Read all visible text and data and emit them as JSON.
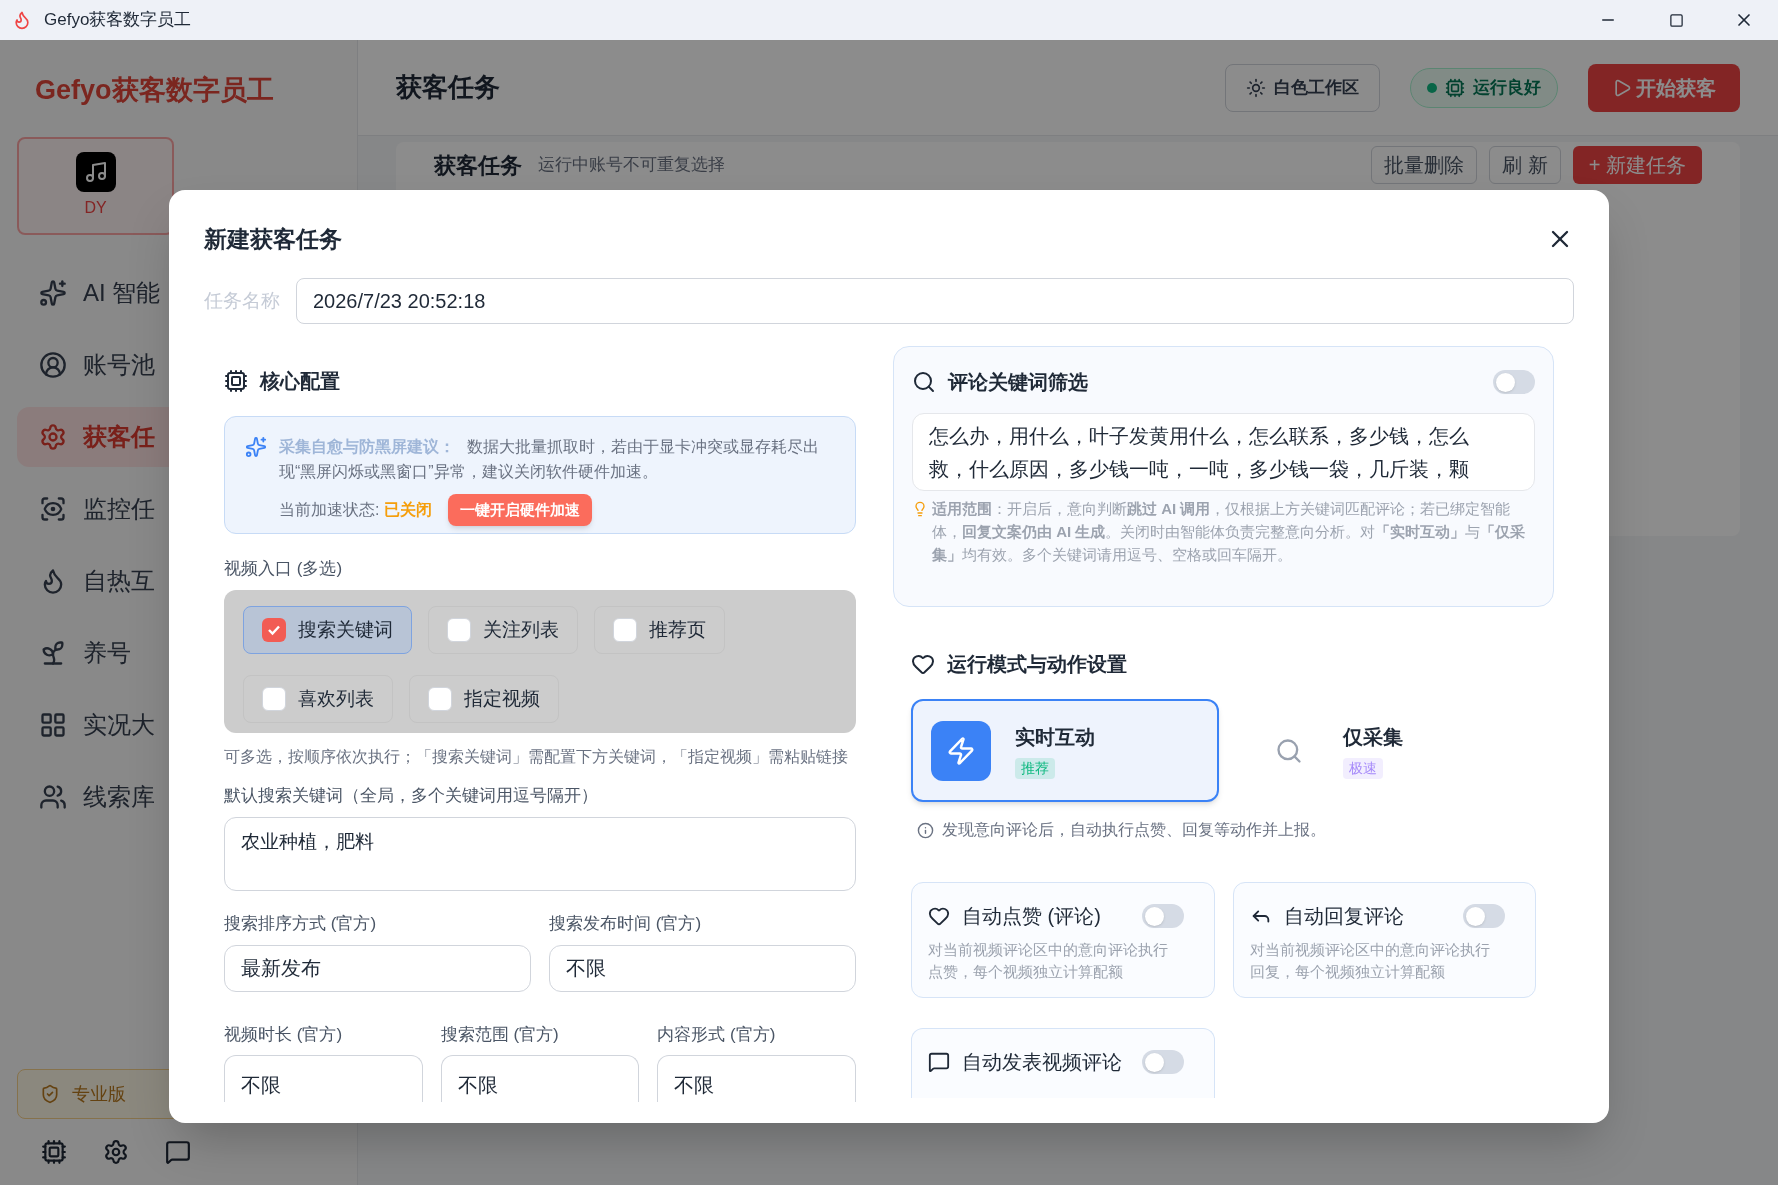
{
  "window": {
    "title": "Gefyo获客数字员工"
  },
  "sidebar": {
    "logo": "Gefyo获客数字员工",
    "platform": {
      "label": "DY"
    },
    "items": [
      {
        "label": "AI 智能",
        "selected": false
      },
      {
        "label": "账号池",
        "selected": false
      },
      {
        "label": "获客任",
        "selected": true
      },
      {
        "label": "监控任",
        "selected": false
      },
      {
        "label": "自热互",
        "selected": false
      },
      {
        "label": "养号",
        "selected": false
      },
      {
        "label": "实况大",
        "selected": false
      },
      {
        "label": "线索库",
        "selected": false
      }
    ],
    "edition": "专业版"
  },
  "header": {
    "title": "获客任务",
    "buttons": [
      {
        "label": "白色工作区",
        "kind": "theme"
      },
      {
        "label": "运行良好",
        "kind": "status"
      },
      {
        "label": "开始获客",
        "kind": "primary"
      }
    ]
  },
  "task_panel": {
    "title": "获客任务",
    "subtitle": "运行中账号不可重复选择",
    "buttons": [
      {
        "label": "批量删除",
        "kind": "outline"
      },
      {
        "label": "刷 新",
        "kind": "outline"
      },
      {
        "label": "+ 新建任务",
        "kind": "primary"
      }
    ]
  },
  "dialog": {
    "title": "新建获客任务",
    "task_name": {
      "label": "任务名称",
      "value": "2026/7/23 20:52:18"
    },
    "core": {
      "title": "核心配置",
      "tip_title": "采集自愈与防黑屏建议：",
      "tip_text": "数据大批量抓取时，若由于显卡冲突或显存耗尽出现“黑屏闪烁或黑窗口”异常，建议关闭软件硬件加速。",
      "accel_label": "当前加速状态:",
      "accel_state": "已关闭",
      "accel_button": "一键开启硬件加速"
    },
    "video_entry": {
      "label": "视频入口 (多选)",
      "options": [
        {
          "label": "搜索关键词",
          "checked": true
        },
        {
          "label": "关注列表",
          "checked": false
        },
        {
          "label": "推荐页",
          "checked": false
        },
        {
          "label": "喜欢列表",
          "checked": false
        },
        {
          "label": "指定视频",
          "checked": false
        }
      ],
      "hint": "可多选，按顺序依次执行；「搜索关键词」需配置下方关键词，「指定视频」需粘贴链接"
    },
    "keywords": {
      "label": "默认搜索关键词（全局，多个关键词用逗号隔开）",
      "value": "农业种植，肥料"
    },
    "selects": [
      {
        "label": "搜索排序方式 (官方)",
        "value": "最新发布"
      },
      {
        "label": "搜索发布时间 (官方)",
        "value": "不限"
      },
      {
        "label": "视频时长 (官方)",
        "value": "不限"
      },
      {
        "label": "搜索范围 (官方)",
        "value": "不限"
      },
      {
        "label": "内容形式 (官方)",
        "value": "不限"
      }
    ],
    "comment_filter": {
      "title": "评论关键词筛选",
      "on": false,
      "value": "怎么办，用什么，叶子发黄用什么，怎么联系，多少钱，怎么救，什么原因，多少钱一吨，一吨，多少钱一袋，几斤装，颗",
      "note": "**适用范围**：开启后，意向判断**跳过 AI 调用**，仅根据上方关键词匹配评论；若已绑定智能体，**回复文案仍由 AI 生成**。关闭时由智能体负责完整意向分析。对**「实时互动」**与**「仅采集」**均有效。多个关键词请用逗号、空格或回车隔开。"
    },
    "run_mode": {
      "title": "运行模式与动作设置",
      "modes": [
        {
          "name": "实时互动",
          "tag": "推荐",
          "color": "#10b981",
          "selected": true
        },
        {
          "name": "仅采集",
          "tag": "极速",
          "color": "#a78bfa",
          "selected": false
        }
      ],
      "info": "发现意向评论后，自动执行点赞、回复等动作并上报。"
    },
    "actions": [
      {
        "title": "自动点赞 (评论)",
        "description": "对当前视频评论区中的意向评论执行点赞，每个视频独立计算配额",
        "on": false
      },
      {
        "title": "自动回复评论",
        "description": "对当前视频评论区中的意向评论执行回复，每个视频独立计算配额",
        "on": false
      },
      {
        "title": "自动发表视频评论",
        "on": false
      }
    ]
  }
}
